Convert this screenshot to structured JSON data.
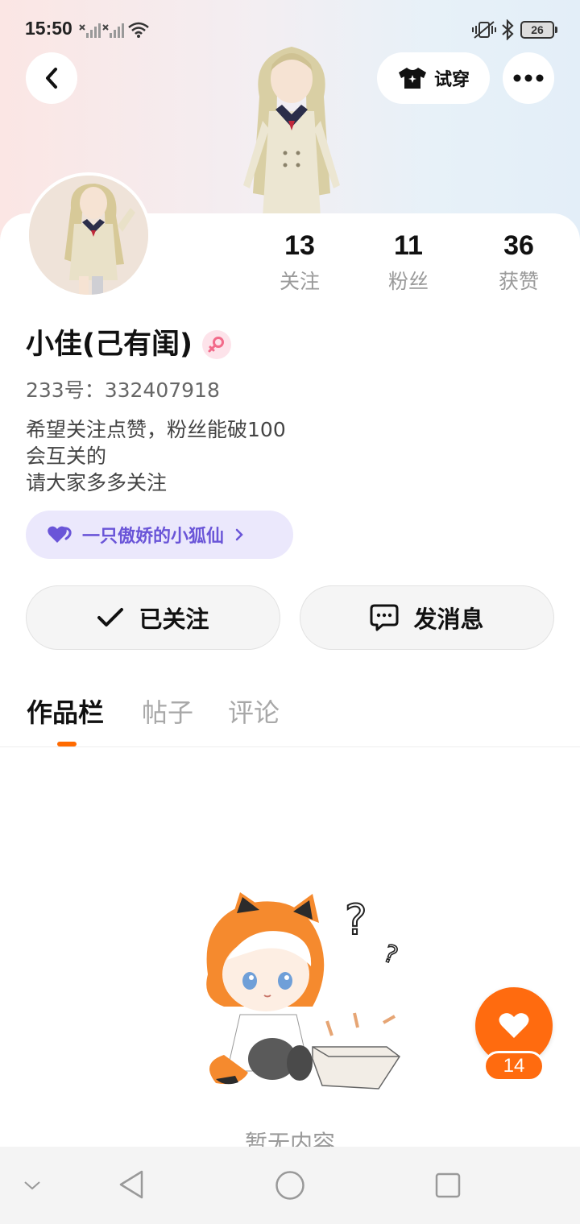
{
  "status_bar": {
    "time": "15:50",
    "battery": "26",
    "icons": [
      "signal-icon",
      "signal-icon",
      "wifi-icon",
      "vibrate-icon",
      "bluetooth-icon",
      "battery-icon"
    ]
  },
  "header": {
    "tryon_label": "试穿",
    "icons": [
      "back-icon",
      "shirt-icon",
      "more-icon"
    ]
  },
  "stats": [
    {
      "value": "13",
      "label": "关注"
    },
    {
      "value": "11",
      "label": "粉丝"
    },
    {
      "value": "36",
      "label": "获赞"
    }
  ],
  "profile": {
    "name": "小佳(己有闺)",
    "gender_icon": "female-icon",
    "uid": "233号：332407918",
    "bio": [
      "希望关注点赞，粉丝能破100",
      "会互关的",
      "请大家多多关注"
    ]
  },
  "fan_tag": {
    "label": "一只傲娇的小狐仙",
    "icon": "heart-icon",
    "color": "#6a55d8"
  },
  "actions": {
    "follow_label": "已关注",
    "message_label": "发消息"
  },
  "tabs": [
    {
      "label": "作品栏",
      "active": true
    },
    {
      "label": "帖子",
      "active": false
    },
    {
      "label": "评论",
      "active": false
    }
  ],
  "empty_state": {
    "text": "暂无内容"
  },
  "like_fab": {
    "count": "14",
    "color": "#ff6b0f"
  },
  "colors": {
    "accent": "#ff6a00",
    "fan_tag_bg": "#ebe8fc"
  }
}
